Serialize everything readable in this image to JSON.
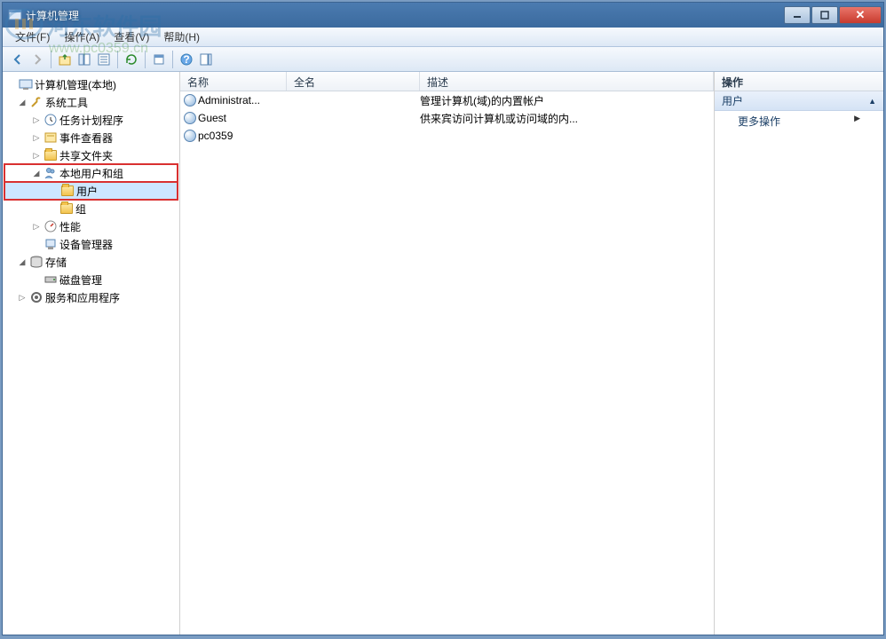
{
  "window": {
    "title": "计算机管理"
  },
  "watermark": {
    "line1": "河东软件园",
    "line2": "www.pc0359.cn"
  },
  "menu": {
    "file": "文件(F)",
    "action": "操作(A)",
    "view": "查看(V)",
    "help": "帮助(H)"
  },
  "tree": {
    "root": "计算机管理(本地)",
    "system_tools": "系统工具",
    "task_scheduler": "任务计划程序",
    "event_viewer": "事件查看器",
    "shared_folders": "共享文件夹",
    "local_users_groups": "本地用户和组",
    "users": "用户",
    "groups": "组",
    "performance": "性能",
    "device_manager": "设备管理器",
    "storage": "存储",
    "disk_management": "磁盘管理",
    "services_apps": "服务和应用程序"
  },
  "list": {
    "col_name": "名称",
    "col_fullname": "全名",
    "col_desc": "描述",
    "rows": [
      {
        "name": "Administrat...",
        "fullname": "",
        "desc": "管理计算机(域)的内置帐户"
      },
      {
        "name": "Guest",
        "fullname": "",
        "desc": "供来宾访问计算机或访问域的内..."
      },
      {
        "name": "pc0359",
        "fullname": "",
        "desc": ""
      }
    ]
  },
  "actions": {
    "header": "操作",
    "category": "用户",
    "more": "更多操作"
  }
}
